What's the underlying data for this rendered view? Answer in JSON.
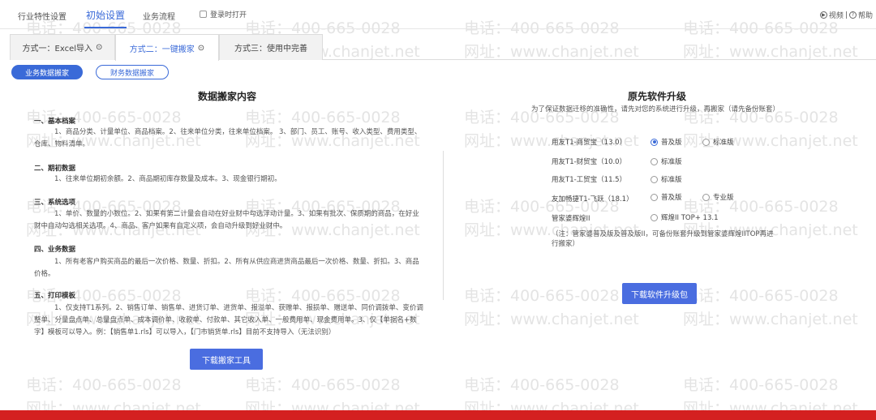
{
  "top_tabs": [
    "行业特性设置",
    "初始设置",
    "业务流程"
  ],
  "login_open_label": "登录时打开",
  "top_right": {
    "video": "视频",
    "help": "帮助"
  },
  "sub_tabs": [
    "方式一：Excel导入",
    "方式二：一键搬家",
    "方式三：使用中完善"
  ],
  "pills": [
    "业务数据搬家",
    "财务数据搬家"
  ],
  "left": {
    "title": "数据搬家内容",
    "sections": [
      {
        "title": "一、基本档案",
        "body": "1、商品分类、计量单位、商品档案。2、往来单位分类，往来单位档案。 3、部门、员工、账号、收入类型、费用类型、仓库、物料清单。"
      },
      {
        "title": "二、期初数据",
        "body": "1、往来单位期初余额。2、商品期初库存数量及成本。3、现金银行期初。"
      },
      {
        "title": "三、系统选项",
        "body": "1、单价、数量的小数位。2、如果有第二计量会自动在好业财中勾选浮动计量。3、如果有批次、保质期的商品，在好业财中自动勾选相关选项。4、商品、客户如果有自定义项，会自动升级到好业财中。"
      },
      {
        "title": "四、业务数据",
        "body": "1、所有老客户购买商品的最后一次价格、数量、折扣。2、所有从供应商进货商品最后一次价格、数量、折扣。3、商品价格。"
      },
      {
        "title": "五、打印模板",
        "body": "1、仅支持T1系列。2、销售订单、销售单、进货订单、进货单、报溢单、获赠单、报损单、赠送单、同价调拨单、变价调整单、分量盘点单、总量盘点单、成本调价单、收款单、付款单、其它收入单、一般费用单、现金费用单。3、仅【单据名+数字】模板可以导入。例：【销售单1.rls】可以导入，【门市销货单.rls】目前不支持导入（无法识别）"
      }
    ],
    "button": "下载搬家工具"
  },
  "right": {
    "title": "原先软件升级",
    "note": "为了保证数据迁移的准确性，请先对您的系统进行升级，再搬家（请先备份账套）",
    "software": [
      {
        "name": "用友T1-商贸宝（13.0）",
        "options": [
          {
            "label": "普及版",
            "checked": true
          },
          {
            "label": "标准版",
            "checked": false
          }
        ]
      },
      {
        "name": "用友T1-财贸宝（10.0）",
        "options": [
          {
            "label": "标准版",
            "checked": false
          }
        ]
      },
      {
        "name": "用友T1-工贸宝（11.5）",
        "options": [
          {
            "label": "标准版",
            "checked": false
          }
        ]
      },
      {
        "name": "友加畅捷T1-飞跃（18.1）",
        "options": [
          {
            "label": "普及版",
            "checked": false
          },
          {
            "label": "专业版",
            "checked": false
          }
        ]
      },
      {
        "name": "管家婆辉煌II",
        "options": [
          {
            "label": "辉煌II TOP+ 13.1",
            "checked": false
          }
        ]
      }
    ],
    "footnote": "（注：管家婆普及版及普及版II，可备份账套升级到管家婆辉煌IITOP再进行搬家）",
    "button": "下载软件升级包"
  },
  "watermark": {
    "phone": "电话：400-665-0028",
    "url": "网址：www.chanjet.net"
  },
  "colors": {
    "accent": "#3a6ad8",
    "button": "#4a6de0",
    "footer": "#d42020"
  }
}
